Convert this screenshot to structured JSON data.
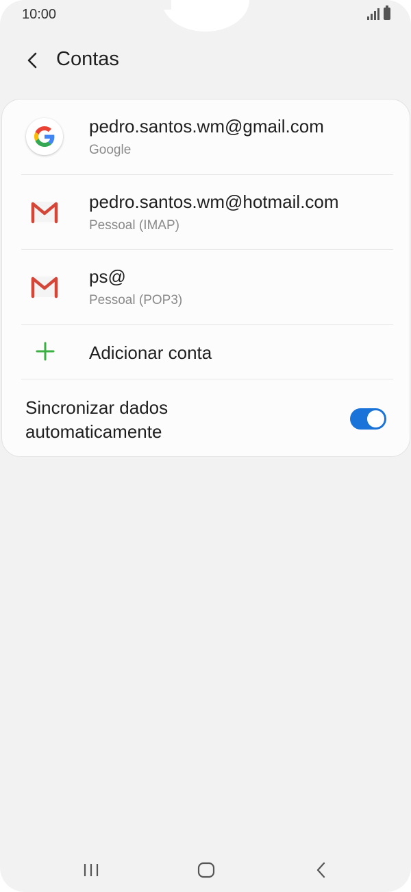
{
  "status_bar": {
    "time": "10:00",
    "signal_icon": "signal-icon",
    "battery_icon": "battery-icon"
  },
  "header": {
    "title": "Contas",
    "back_icon": "chevron-left-icon"
  },
  "accounts": [
    {
      "email": "pedro.santos.wm@gmail.com",
      "type": "Google",
      "icon": "google-icon"
    },
    {
      "email": "pedro.santos.wm@hotmail.com",
      "type": "Pessoal (IMAP)",
      "icon": "gmail-icon"
    },
    {
      "email": "ps@",
      "type": "Pessoal (POP3)",
      "icon": "gmail-icon"
    }
  ],
  "add_account": {
    "label": "Adicionar conta",
    "icon": "plus-icon",
    "icon_color": "#3cb043"
  },
  "sync": {
    "label": "Sincronizar dados automaticamente",
    "enabled": true,
    "toggle_color": "#1a73d9"
  },
  "nav_bar": {
    "recent_icon": "recent-apps-icon",
    "home_icon": "home-icon",
    "back_icon": "back-icon"
  },
  "colors": {
    "background": "#f2f2f2",
    "card": "#fcfcfc",
    "secondary_text": "#8a8a8a",
    "gmail_red": "#d44638"
  }
}
